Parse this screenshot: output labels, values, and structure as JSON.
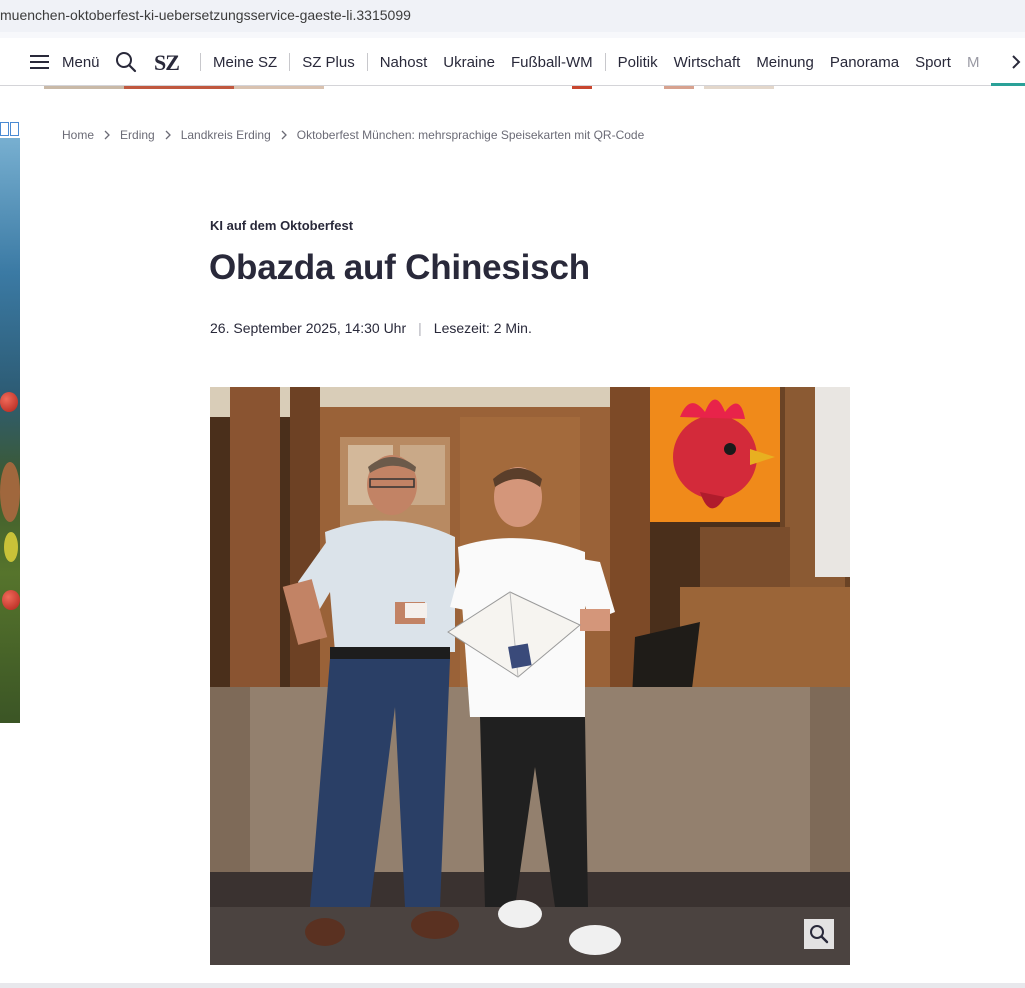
{
  "browser": {
    "url": "muenchen-oktoberfest-ki-uebersetzungsservice-gaeste-li.3315099"
  },
  "nav": {
    "menu_label": "Menü",
    "logo": "SZ",
    "items_group1": [
      "Meine SZ"
    ],
    "items_group2": [
      "SZ Plus"
    ],
    "items_group3": [
      "Nahost",
      "Ukraine",
      "Fußball-WM"
    ],
    "items_group4": [
      "Politik",
      "Wirtschaft",
      "Meinung",
      "Panorama",
      "Sport"
    ],
    "truncated_item": "M",
    "accent_color": "#2aa198"
  },
  "breadcrumb": {
    "items": [
      "Home",
      "Erding",
      "Landkreis Erding",
      "Oktoberfest München: mehrsprachige Speisekarten mit QR-Code"
    ]
  },
  "article": {
    "kicker": "KI auf dem Oktoberfest",
    "title": "Obazda auf Chinesisch",
    "date": "26. September 2025, 14:30 Uhr",
    "divider": "|",
    "reading_time": "Lesezeit: 2 Min."
  },
  "icons": {
    "menu": "hamburger-icon",
    "search": "search-icon",
    "nav_next": "chevron-right-icon",
    "zoom": "zoom-icon"
  }
}
